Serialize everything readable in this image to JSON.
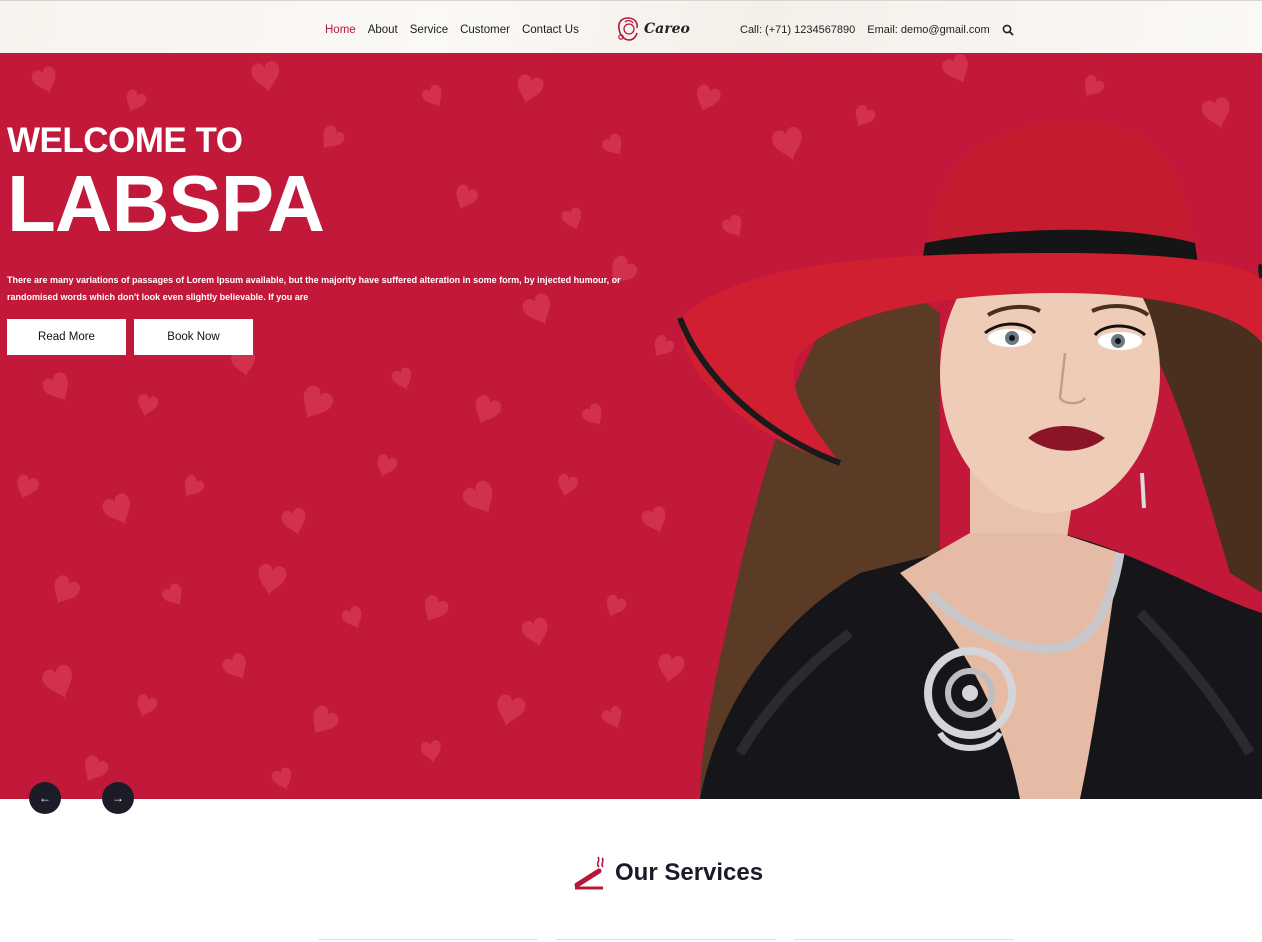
{
  "header": {
    "nav": [
      {
        "label": "Home",
        "active": true
      },
      {
        "label": "About"
      },
      {
        "label": "Service"
      },
      {
        "label": "Customer"
      },
      {
        "label": "Contact Us"
      }
    ],
    "logo_text": "Careo",
    "call": "Call: (+71) 1234567890",
    "email": "Email: demo@gmail.com",
    "search_icon": "search-icon"
  },
  "hero": {
    "welcome": "WELCOME TO",
    "brand": "LABSPA",
    "description": "There are many variations of passages of Lorem Ipsum available, but the majority have suffered alteration in some form, by injected humour, or randomised words which don't look even slightly believable. If you are",
    "read_more": "Read More",
    "book_now": "Book Now",
    "prev_arrow": "←",
    "next_arrow": "→"
  },
  "services": {
    "title": "Our Services"
  },
  "colors": {
    "accent": "#c2183a",
    "nav_active": "#b5173a",
    "dark": "#1c1c28"
  }
}
